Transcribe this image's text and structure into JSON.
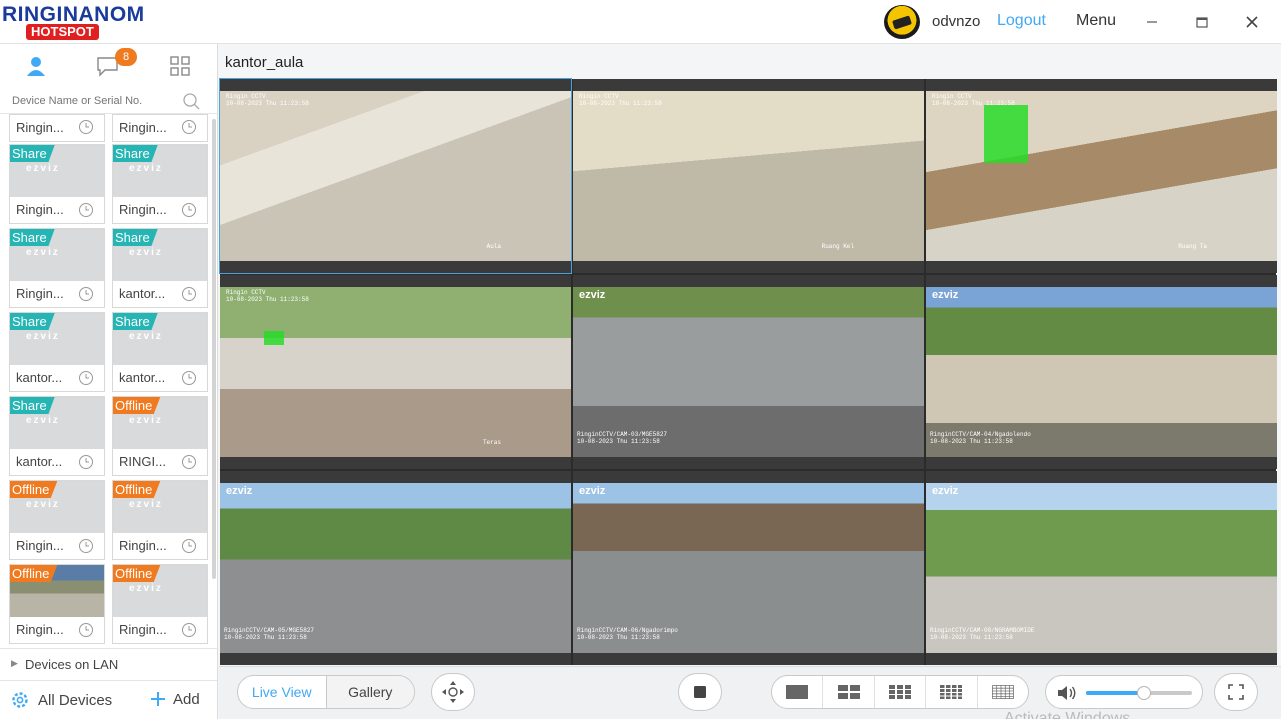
{
  "app": {
    "logo_line1": "RINGINANOM",
    "logo_line2": "HOTSPOT"
  },
  "header": {
    "username": "odvnzo",
    "logout_label": "Logout",
    "menu_label": "Menu"
  },
  "sidebar": {
    "message_count": "8",
    "search_placeholder": "Device Name or Serial No.",
    "brand_watermark": "ezviz",
    "devices": [
      {
        "label": "Ringin...",
        "tag": ""
      },
      {
        "label": "Ringin...",
        "tag": ""
      },
      {
        "label": "Ringin...",
        "tag": "Share"
      },
      {
        "label": "Ringin...",
        "tag": "Share"
      },
      {
        "label": "Ringin...",
        "tag": "Share"
      },
      {
        "label": "kantor...",
        "tag": "Share"
      },
      {
        "label": "kantor...",
        "tag": "Share"
      },
      {
        "label": "kantor...",
        "tag": "Share"
      },
      {
        "label": "kantor...",
        "tag": "Share"
      },
      {
        "label": "RINGI...",
        "tag": "Offline"
      },
      {
        "label": "Ringin...",
        "tag": "Offline"
      },
      {
        "label": "Ringin...",
        "tag": "Offline"
      },
      {
        "label": "Ringin...",
        "tag": "Offline"
      },
      {
        "label": "Ringin...",
        "tag": "Offline"
      }
    ],
    "lan_label": "Devices on LAN",
    "all_devices_label": "All Devices",
    "add_label": "Add"
  },
  "main": {
    "group_title": "kantor_aula",
    "tiles": [
      {
        "osd_top": "Ringin CCTV\n10-08-2023 Thu 11:23:58",
        "osd_bottom": "Aula",
        "scene": "indoor",
        "ez": ""
      },
      {
        "osd_top": "Ringin CCTV\n10-08-2023 Thu 11:23:58",
        "osd_bottom": "Ruang Kel",
        "scene": "office",
        "ez": ""
      },
      {
        "osd_top": "Ringin CCTV\n10-08-2023 Thu 11:23:58",
        "osd_bottom": "Ruang Ta",
        "scene": "lounge",
        "ez": ""
      },
      {
        "osd_top": "Ringin CCTV\n10-08-2023 Thu 11:23:58",
        "osd_bottom": "Teras",
        "scene": "porch",
        "ez": ""
      },
      {
        "osd_top": "",
        "osd_bottom": "RinginCCTV/CAM-03/MGE5827\n10-08-2023 Thu 11:23:58",
        "scene": "road",
        "ez": "ezviz"
      },
      {
        "osd_top": "",
        "osd_bottom": "RinginCCTV/CAM-04/Ngadolendo\n10-08-2023 Thu 11:23:58",
        "scene": "path",
        "ez": "ezviz"
      },
      {
        "osd_top": "",
        "osd_bottom": "RinginCCTV/CAM-05/MGE5827\n10-08-2023 Thu 11:23:58",
        "scene": "curve",
        "ez": "ezviz"
      },
      {
        "osd_top": "",
        "osd_bottom": "RinginCCTV/CAM-06/Ngadorimpo\n10-08-2023 Thu 11:23:58",
        "scene": "village",
        "ez": "ezviz"
      },
      {
        "osd_top": "",
        "osd_bottom": "RinginCCTV/CAM-08/NGRAMBOMIDE\n10-08-2023 Thu 11:23:58",
        "scene": "field",
        "ez": "ezviz"
      }
    ]
  },
  "toolbar": {
    "liveview_label": "Live View",
    "gallery_label": "Gallery",
    "volume_level": 0.55
  },
  "watermark": "Activate Windows",
  "colors": {
    "accent": "#3fa9f5",
    "share": "#26b5b5",
    "offline": "#f07a1f"
  }
}
